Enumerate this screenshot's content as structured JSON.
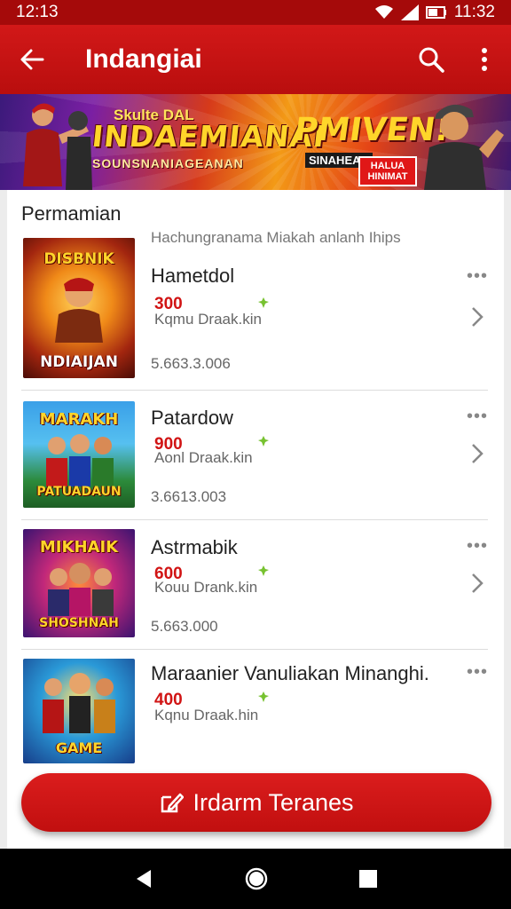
{
  "status_bar": {
    "time_left": "12:13",
    "time_right": "11:32"
  },
  "app_bar": {
    "title": "Indangiai"
  },
  "banner": {
    "small_text": "Skulte DAL",
    "title": "INDAEMIANAI",
    "subtitle": "SOUNSNANIAGEANAN",
    "promo_title": "PMIVEN!",
    "promo_sub": "SINAHEAR",
    "promo_tag": "HALUA HINIMAT"
  },
  "section": {
    "title": "Permamian",
    "subtitle": "Hachungranama Miakah anlanh Ihips"
  },
  "games": [
    {
      "name": "Hametdol",
      "price": "300",
      "sub": "Kqmu Draak.kin",
      "count": "5.663.3.006",
      "thumb_top": "DISBNIK",
      "thumb_bottom": "NDIAIJAN"
    },
    {
      "name": "Patardow",
      "price": "900",
      "sub": "Aonl Draak.kin",
      "count": "3.6613.003",
      "thumb_top": "MARAKH",
      "thumb_bottom": "PATUADAUN"
    },
    {
      "name": "Astrmabik",
      "price": "600",
      "sub": "Kouu Drank.kin",
      "count": "5.663.000",
      "thumb_top": "MIKHAIK",
      "thumb_bottom": "SHOSHNAH"
    },
    {
      "name": "Maraanier Vanuliakan Minanghi.",
      "price": "400",
      "sub": "Kqnu Draak.hin",
      "count": "",
      "thumb_top": "",
      "thumb_bottom": "GAME"
    }
  ],
  "cta": {
    "label": "Irdarm Teranes"
  },
  "colors": {
    "primary": "#c91111",
    "price": "#d11414",
    "status_bar": "#a50a0a"
  }
}
